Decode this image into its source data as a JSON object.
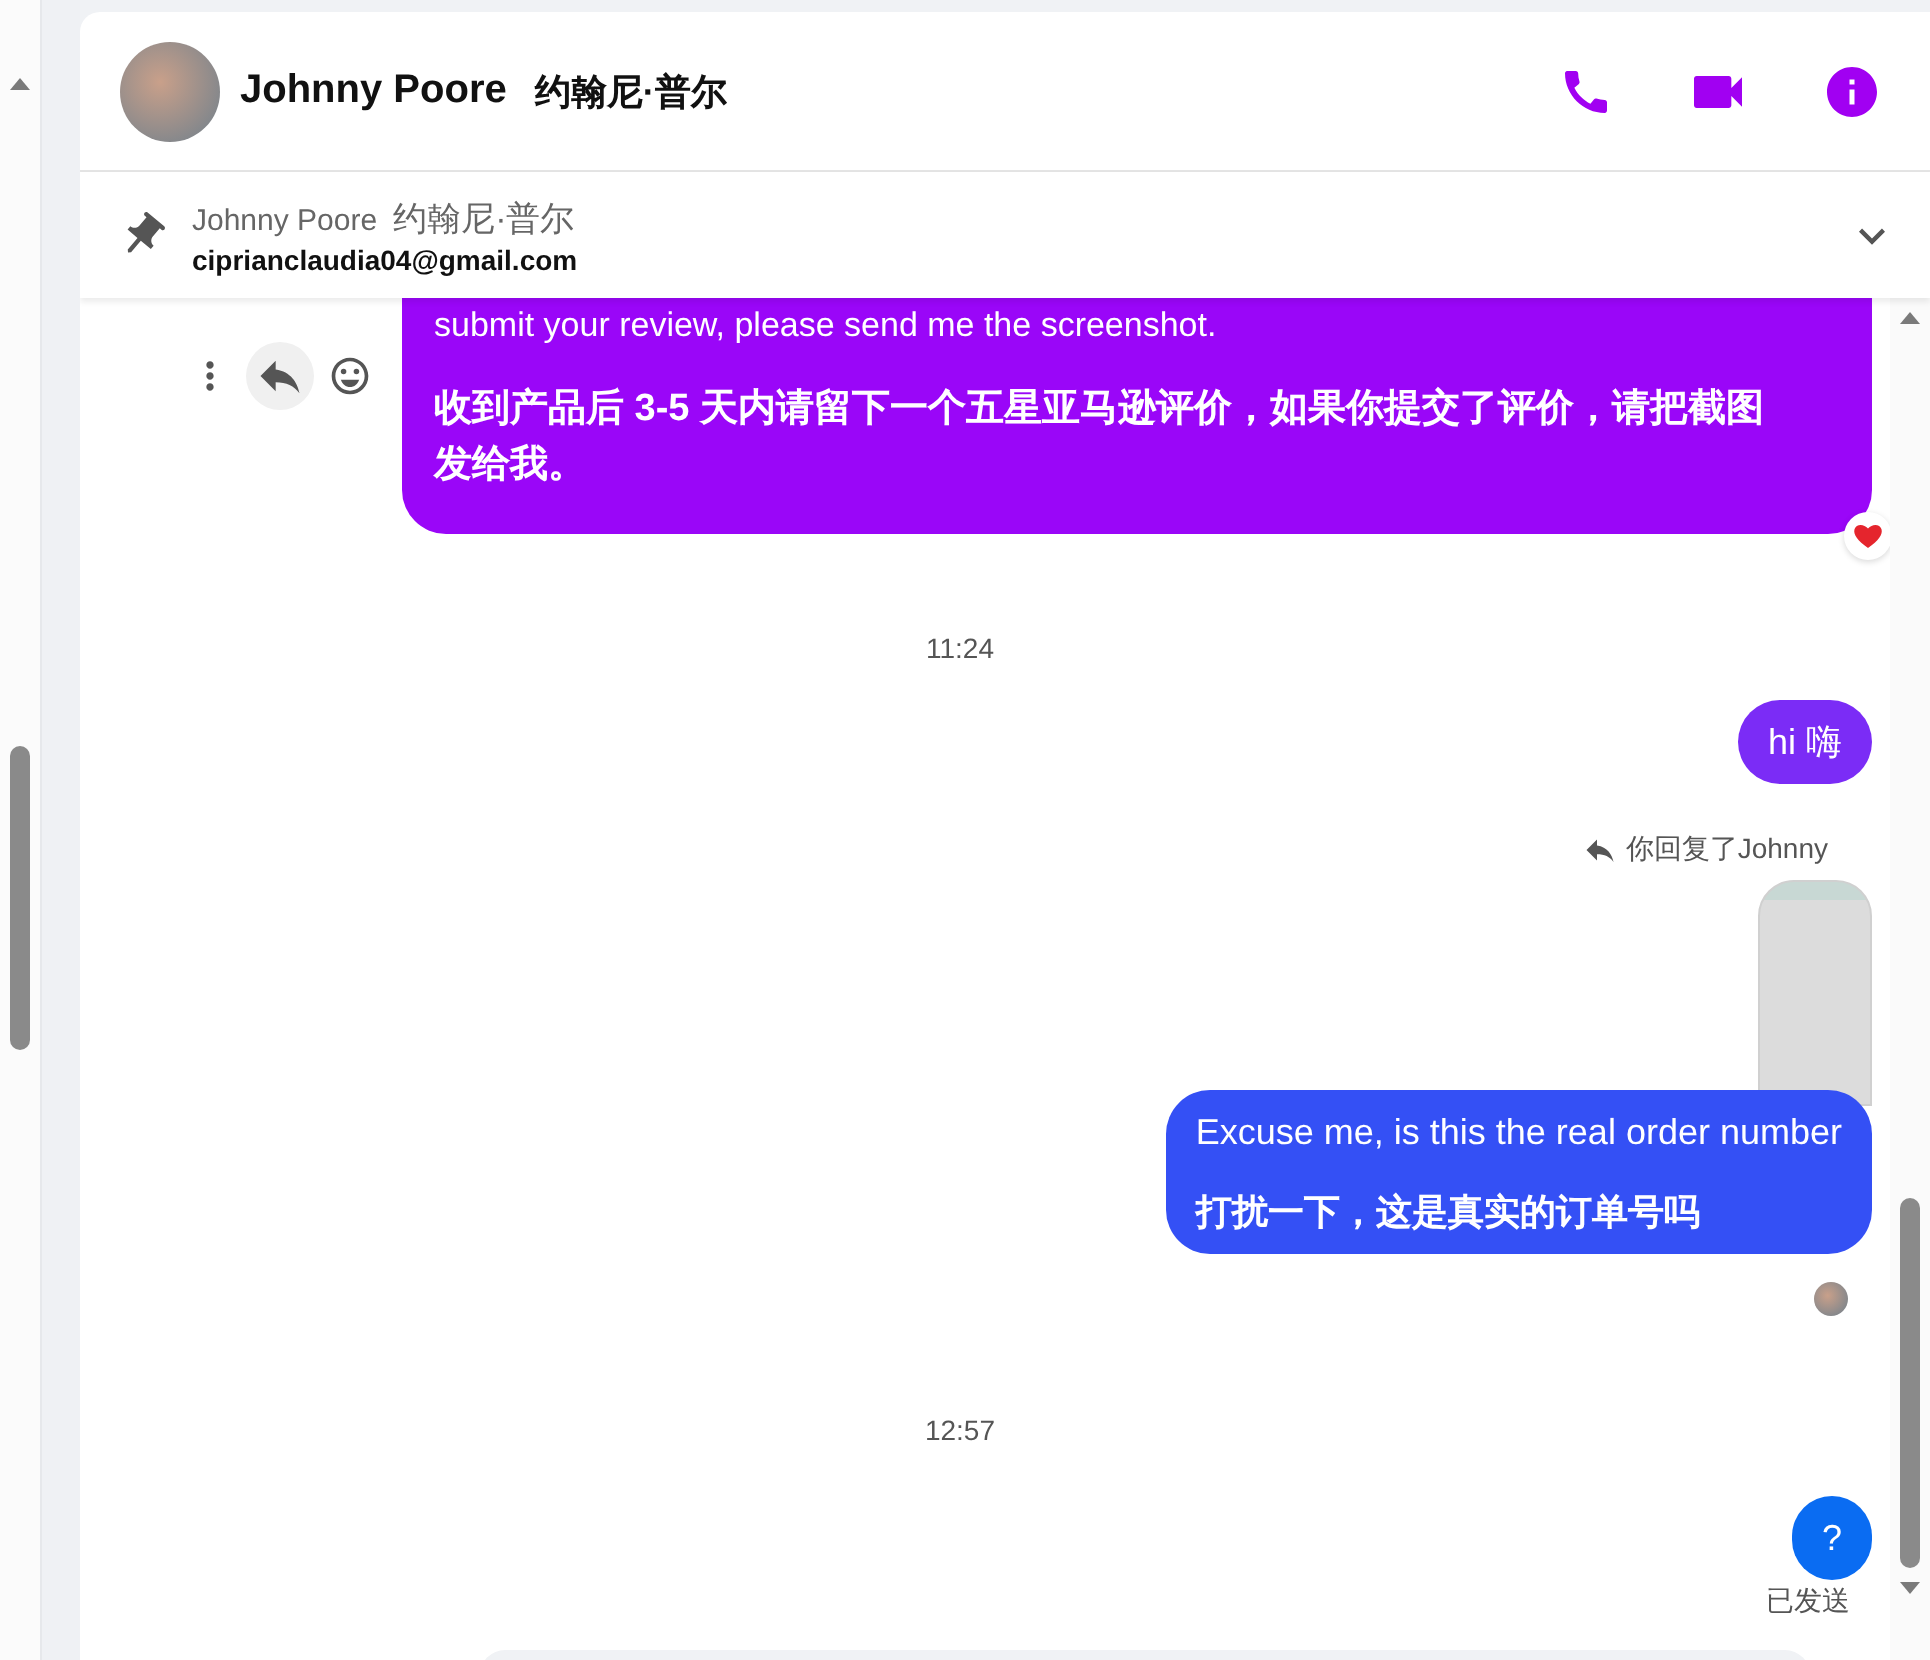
{
  "header": {
    "name": "Johnny Poore",
    "name_cn": "约翰尼·普尔"
  },
  "pinned": {
    "name": "Johnny Poore",
    "name_cn": "约翰尼·普尔",
    "email": "ciprianclaudia04@gmail.com"
  },
  "messages": [
    {
      "kind": "bubble",
      "paragraphs": [
        {
          "text": "submit your review, please send me the screenshot.",
          "bold": false
        },
        {
          "text": "收到产品后 3-5 天内请留下一个五星亚马逊评价，如果你提交了评价，请把截图发给我。",
          "bold": true
        }
      ],
      "color": "#9a06f8",
      "hovered": true,
      "reaction": true
    },
    {
      "kind": "time",
      "text": "11:24"
    },
    {
      "kind": "bubble",
      "paragraphs": [
        {
          "text": "hi  嗨",
          "bold": false
        }
      ],
      "color": "#7b2cf6",
      "hovered": false,
      "reaction": false
    },
    {
      "kind": "reply",
      "text": "你回复了Johnny"
    },
    {
      "kind": "image"
    },
    {
      "kind": "bubble",
      "paragraphs": [
        {
          "text": "Excuse me, is this the real order number",
          "bold": false
        },
        {
          "text": "打扰一下，这是真实的订单号吗",
          "bold": true
        }
      ],
      "color": "#3450f5",
      "hovered": false,
      "reaction": false
    },
    {
      "kind": "seen"
    },
    {
      "kind": "time",
      "text": "12:57"
    },
    {
      "kind": "bubble",
      "paragraphs": [
        {
          "text": "?",
          "bold": false
        }
      ],
      "color": "#0a6cf2",
      "hovered": false,
      "reaction": false
    },
    {
      "kind": "status",
      "text": "已发送"
    }
  ]
}
